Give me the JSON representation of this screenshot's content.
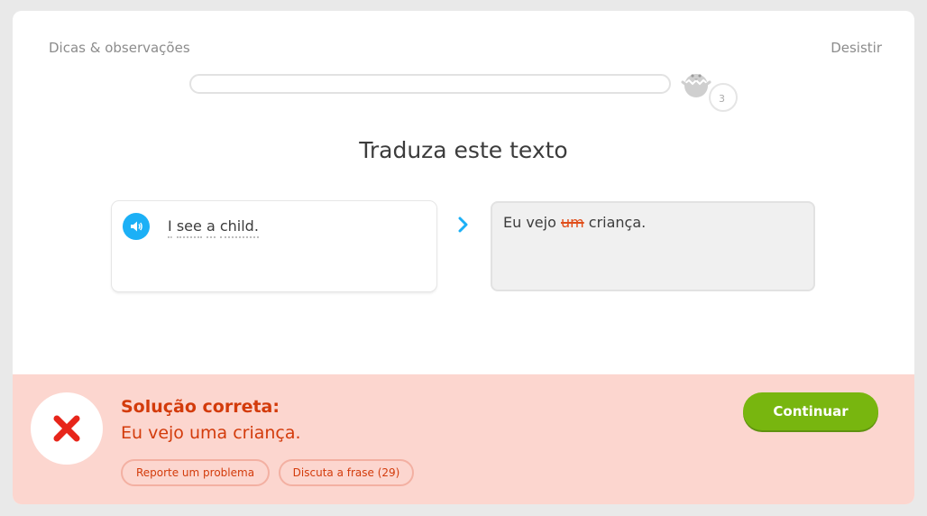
{
  "header": {
    "tips_label": "Dicas & observações",
    "quit_label": "Desistir",
    "progress": 0.0,
    "step_number": "3"
  },
  "prompt": {
    "title": "Traduza este texto",
    "source_sentence": "I see a child.",
    "source_words": [
      "I",
      "see",
      "a",
      "child."
    ],
    "speaker_icon": "speaker-icon"
  },
  "answer": {
    "before_wrong": "Eu vejo ",
    "wrong_word": "um",
    "after_wrong": " criança."
  },
  "feedback": {
    "label": "Solução correta:",
    "correct_solution": "Eu vejo uma criança.",
    "report_label": "Reporte um problema",
    "discuss_label": "Discuta a frase (29)",
    "continue_label": "Continuar",
    "status_icon": "x-icon"
  },
  "colors": {
    "accent_blue": "#1cb0f6",
    "error_red": "#d33b0b",
    "footer_bg": "#fcd6cf",
    "continue_green": "#78b60f"
  }
}
